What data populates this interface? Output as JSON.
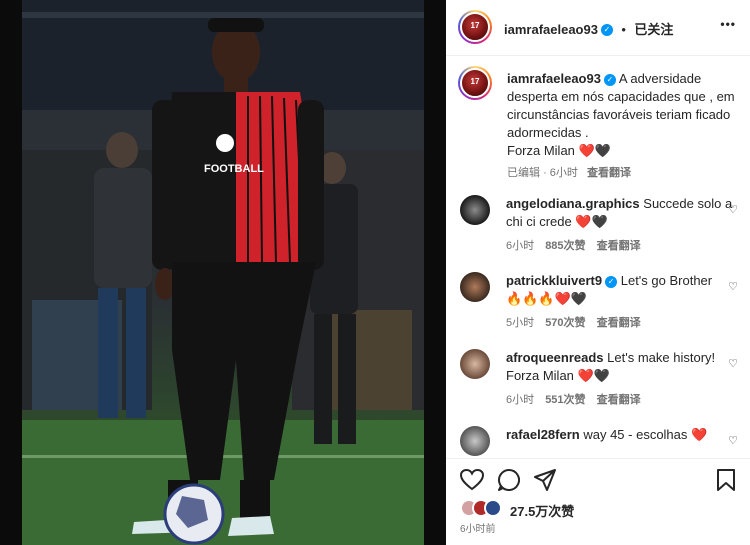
{
  "colors": {
    "accent": "#0095f6",
    "red_heart": "#ed1c24",
    "pitch": "#3b6b34"
  },
  "post": {
    "image_alt_icon": "soccer-player-photo",
    "jersey_text": "FOOTBALL",
    "header": {
      "username": "iamrafaeleao93",
      "dot": "•",
      "follow_state": "已关注",
      "more": "•••"
    },
    "caption": {
      "username": "iamrafaeleao93",
      "text": "A adversidade desperta em nós capacidades que , em circunstâncias favoráveis teriam ficado adormecidas .",
      "line2": "Forza Milan",
      "hearts": "❤️🖤",
      "edited": "已编辑",
      "dot": "·",
      "time": "6小时",
      "translate": "查看翻译"
    },
    "comments": [
      {
        "username": "angelodiana.graphics",
        "text": "Succede solo a chi ci crede",
        "emoji": "❤️🖤",
        "time": "6小时",
        "likes": "885次赞",
        "translate": "查看翻译",
        "verified": false
      },
      {
        "username": "patrickkluivert9",
        "text": "Let's go Brother",
        "emoji": "🔥🔥🔥❤️🖤",
        "time": "5小时",
        "likes": "570次赞",
        "translate": "查看翻译",
        "verified": true
      },
      {
        "username": "afroqueenreads",
        "text": "Let's make history! Forza Milan",
        "emoji": "❤️🖤",
        "time": "6小时",
        "likes": "551次赞",
        "translate": "查看翻译",
        "verified": false
      },
      {
        "username": "rafael28fern",
        "text": "way 45 - escolhas",
        "emoji": "❤️",
        "time": "",
        "likes": "",
        "translate": "",
        "verified": false
      }
    ],
    "likes_count": "27.5万次赞",
    "posted_time": "6小时前"
  }
}
